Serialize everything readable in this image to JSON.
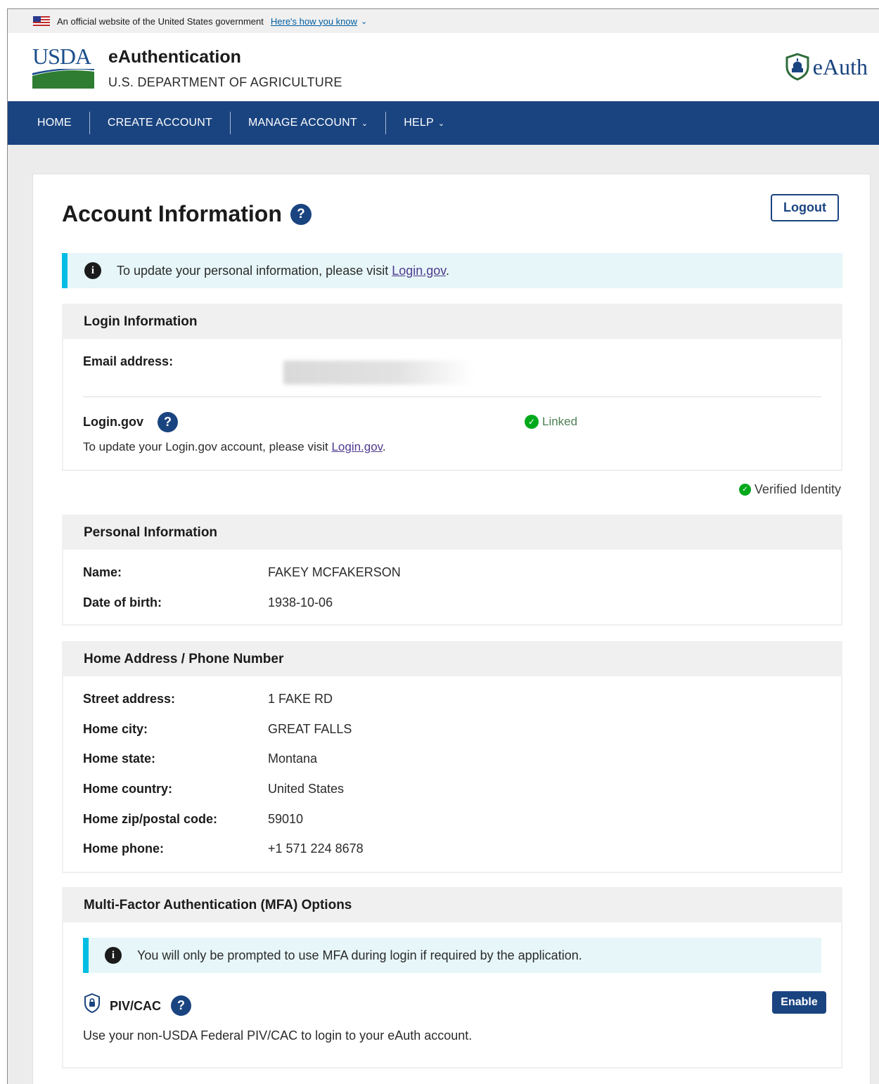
{
  "gov_banner": {
    "text": "An official website of the United States government",
    "link": "Here's how you know"
  },
  "header": {
    "logo_text": "USDA",
    "title": "eAuthentication",
    "subtitle": "U.S. DEPARTMENT OF AGRICULTURE",
    "brand_text": "eAuth"
  },
  "nav": {
    "items": [
      {
        "label": "HOME"
      },
      {
        "label": "CREATE ACCOUNT"
      },
      {
        "label": "MANAGE ACCOUNT"
      },
      {
        "label": "HELP"
      }
    ]
  },
  "page": {
    "title": "Account Information",
    "logout_label": "Logout",
    "help_glyph": "?",
    "alert_prefix": "To update your personal information, please visit ",
    "alert_link": "Login.gov",
    "alert_suffix": "."
  },
  "login_info": {
    "heading": "Login Information",
    "email_label": "Email address:",
    "logingov_label": "Login.gov",
    "logingov_desc_prefix": "To update your Login.gov account, please visit ",
    "logingov_link": "Login.gov",
    "logingov_desc_suffix": ".",
    "status": "Linked",
    "status_color": "#00a91c"
  },
  "verified_identity": "Verified Identity",
  "personal_info": {
    "heading": "Personal Information",
    "fields": [
      {
        "label": "Name:",
        "value": "FAKEY MCFAKERSON"
      },
      {
        "label": "Date of birth:",
        "value": "1938-10-06"
      }
    ]
  },
  "address": {
    "heading": "Home Address / Phone Number",
    "fields": [
      {
        "label": "Street address:",
        "value": "1 FAKE RD"
      },
      {
        "label": "Home city:",
        "value": "GREAT FALLS"
      },
      {
        "label": "Home state:",
        "value": "Montana"
      },
      {
        "label": "Home country:",
        "value": "United States"
      },
      {
        "label": "Home zip/postal code:",
        "value": "59010"
      },
      {
        "label": "Home phone:",
        "value": "+1 571 224 8678"
      }
    ]
  },
  "mfa": {
    "heading": "Multi-Factor Authentication (MFA) Options",
    "alert": "You will only be prompted to use MFA during login if required by the application.",
    "piv_label": "PIV/CAC",
    "piv_desc": "Use your non-USDA Federal PIV/CAC to login to your eAuth account.",
    "enable_label": "Enable"
  },
  "colors": {
    "nav_bg": "#1a4480",
    "accent": "#1a4480",
    "info_border": "#00bde3",
    "info_bg": "#e7f6f8",
    "success": "#00a91c"
  }
}
